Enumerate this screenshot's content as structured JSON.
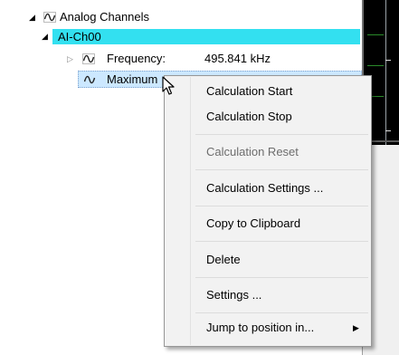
{
  "tree": {
    "root_label": "Analog Channels",
    "channel_label": "AI-Ch00",
    "frequency": {
      "label": "Frequency:",
      "value": "495.841 kHz"
    },
    "maximum_label": "Maximum"
  },
  "context_menu": {
    "items": [
      {
        "label": "Calculation Start",
        "enabled": true
      },
      {
        "label": "Calculation Stop",
        "enabled": true
      },
      {
        "label": "Calculation Reset",
        "enabled": false
      },
      {
        "label": "Calculation Settings ...",
        "enabled": true
      },
      {
        "label": "Copy to Clipboard",
        "enabled": true
      },
      {
        "label": "Delete",
        "enabled": true
      },
      {
        "label": "Settings ...",
        "enabled": true
      },
      {
        "label": "Jump to position in...",
        "enabled": true,
        "has_submenu": true
      }
    ]
  },
  "icons": {
    "expanded": "expanded-triangle-icon",
    "collapsed": "collapsed-triangle-icon",
    "signal": "sine-wave-icon",
    "submenu": "submenu-arrow-icon",
    "cursor": "mouse-pointer-icon"
  },
  "colors": {
    "selection_cyan": "#33e0f0",
    "hover_blue": "#cce8ff",
    "menu_bg": "#f2f2f2",
    "disabled_text": "#6d6d6d",
    "chart_bg": "#000000"
  }
}
